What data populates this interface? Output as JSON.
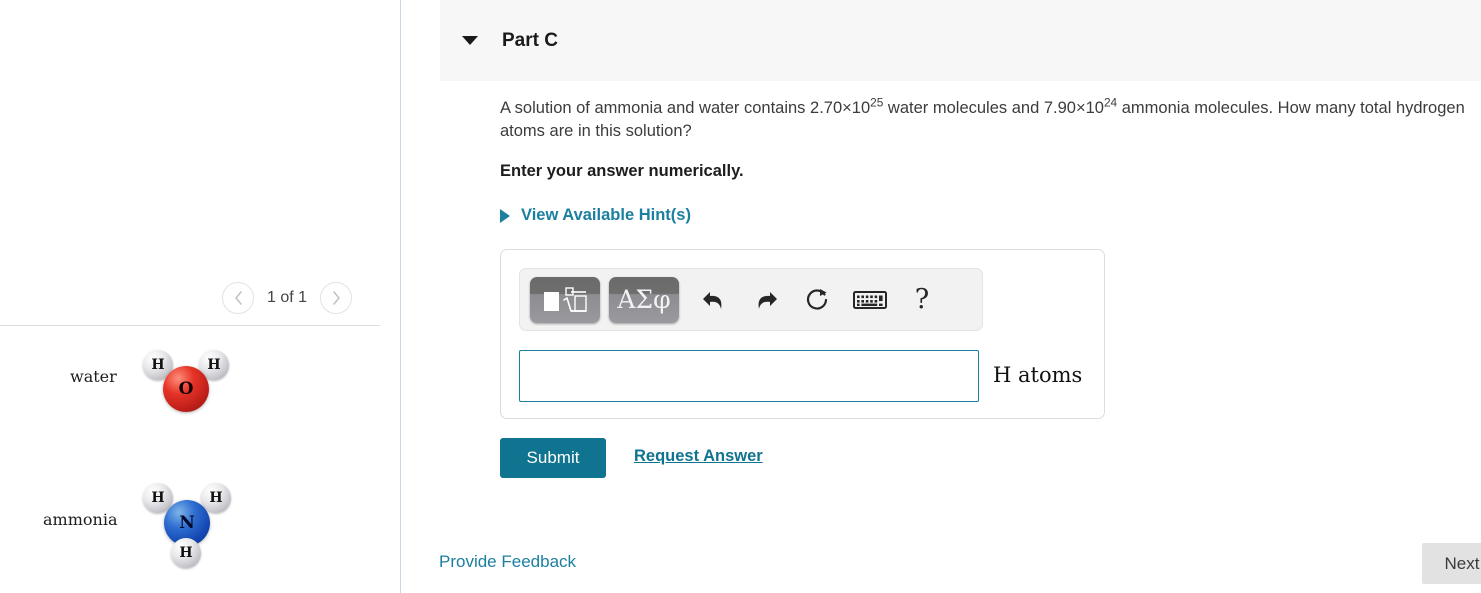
{
  "sidebar": {
    "pager": {
      "prev_icon": "chevron-left-icon",
      "next_icon": "chevron-right-icon",
      "label": "1 of 1"
    },
    "molecules": [
      {
        "name": "water",
        "label": "water",
        "center_atom": "O",
        "center_color": "#d42a21",
        "hydrogens": [
          "H",
          "H"
        ],
        "hydrogen_color": "#d8d8dd"
      },
      {
        "name": "ammonia",
        "label": "ammonia",
        "center_atom": "N",
        "center_color": "#1a52bd",
        "hydrogens": [
          "H",
          "H",
          "H"
        ],
        "hydrogen_color": "#d8d8dd"
      }
    ]
  },
  "main": {
    "part": {
      "caret_icon": "caret-down-icon",
      "title": "Part C"
    },
    "question": {
      "text_part1": "A solution of ammonia and water contains 2.70×10",
      "exp1": "25",
      "text_part2": " water molecules and 7.90×10",
      "exp2": "24",
      "text_part3": " ammonia molecules. How many total hydrogen atoms are in this solution?",
      "value1": "2.70×10²⁵",
      "value2": "7.90×10²⁴"
    },
    "instruction": "Enter your answer numerically.",
    "hints": {
      "caret_icon": "caret-right-icon",
      "label": "View Available Hint(s)"
    },
    "math_toolbar": {
      "buttons": [
        {
          "name": "template-radical-button",
          "icon": "square-root-template-icon",
          "label": ""
        },
        {
          "name": "greek-symbols-button",
          "icon": "greek-letters-icon",
          "label": "ΑΣφ"
        },
        {
          "name": "undo-button",
          "icon": "undo-arrow-icon",
          "label": ""
        },
        {
          "name": "redo-button",
          "icon": "redo-arrow-icon",
          "label": ""
        },
        {
          "name": "reset-button",
          "icon": "refresh-circle-icon",
          "label": ""
        },
        {
          "name": "keyboard-button",
          "icon": "keyboard-icon",
          "label": ""
        },
        {
          "name": "help-button",
          "icon": "question-mark-icon",
          "label": "?"
        }
      ]
    },
    "answer": {
      "value": "",
      "placeholder": "",
      "unit": "H atoms"
    },
    "submit_label": "Submit",
    "request_answer_label": "Request Answer",
    "provide_feedback_label": "Provide Feedback",
    "next_label": "Next"
  },
  "colors": {
    "accent_teal": "#10738f",
    "link_blue": "#1b7fa0",
    "header_bg": "#f7f7f7",
    "input_border": "#1b7fa0",
    "next_bg": "#e2e2e2"
  }
}
